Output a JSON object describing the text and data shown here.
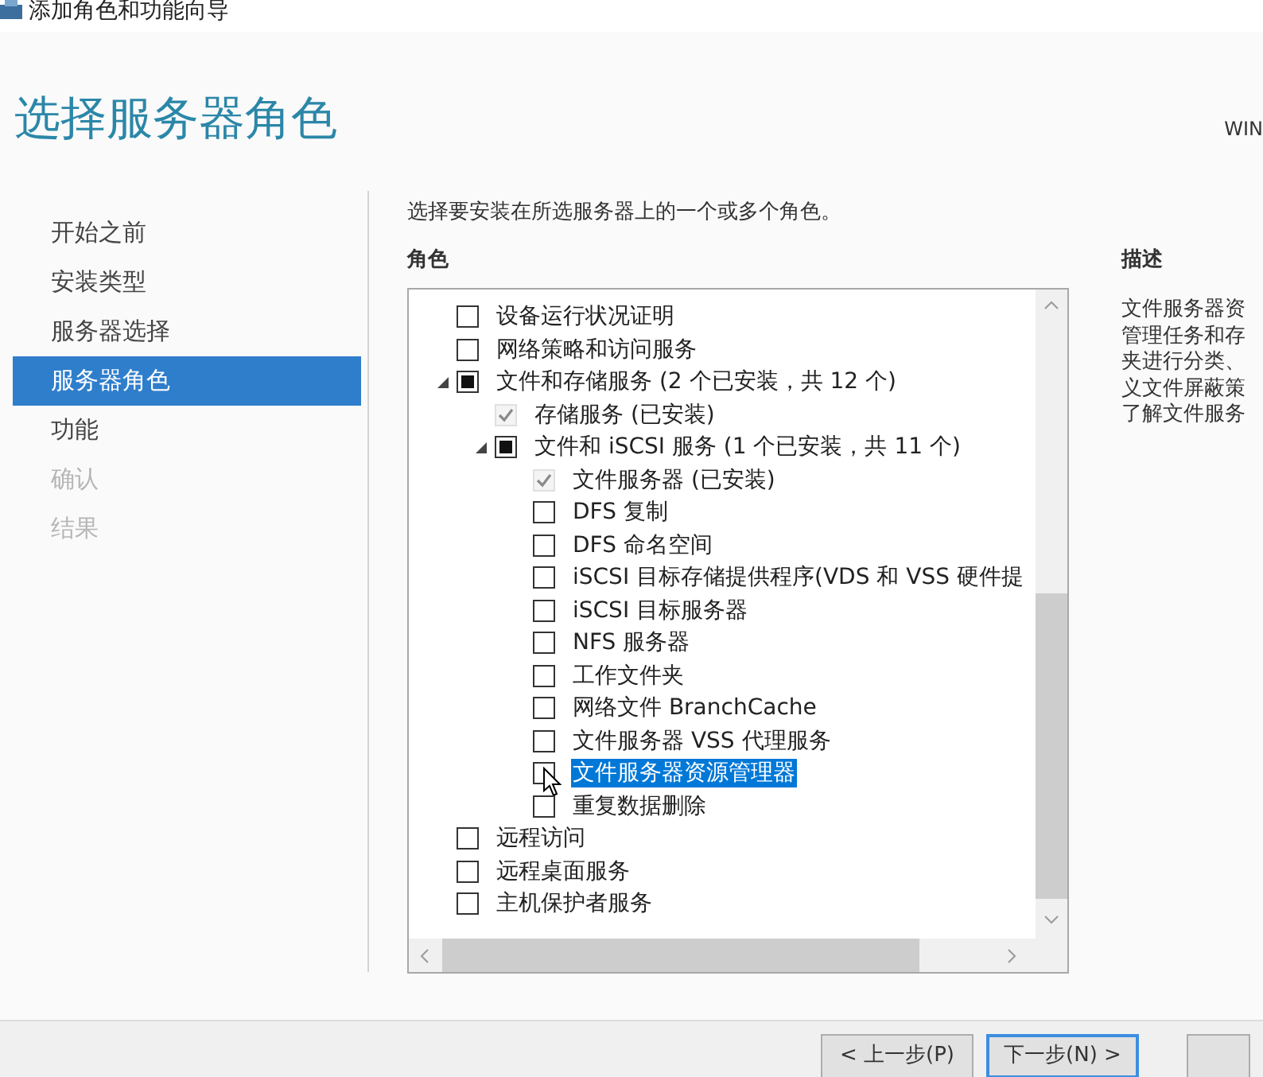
{
  "window": {
    "title": "添加角色和功能向导"
  },
  "heading": "选择服务器角色",
  "server_name": "WIN",
  "steps": [
    {
      "label": "开始之前",
      "selected": false,
      "disabled": false
    },
    {
      "label": "安装类型",
      "selected": false,
      "disabled": false
    },
    {
      "label": "服务器选择",
      "selected": false,
      "disabled": false
    },
    {
      "label": "服务器角色",
      "selected": true,
      "disabled": false
    },
    {
      "label": "功能",
      "selected": false,
      "disabled": false
    },
    {
      "label": "确认",
      "selected": false,
      "disabled": true
    },
    {
      "label": "结果",
      "selected": false,
      "disabled": true
    }
  ],
  "instruction": "选择要安装在所选服务器上的一个或多个角色。",
  "roles_label": "角色",
  "roles": [
    {
      "label": "设备运行状况证明",
      "checked": false,
      "indeterminate": false,
      "disabled": false,
      "selected": false
    },
    {
      "label": "网络策略和访问服务",
      "checked": false,
      "indeterminate": false,
      "disabled": false,
      "selected": false
    },
    {
      "label": "文件和存储服务 (2 个已安装，共 12 个)",
      "checked": false,
      "indeterminate": true,
      "disabled": false,
      "selected": false,
      "expanded": true,
      "children": [
        {
          "label": "存储服务 (已安装)",
          "checked": true,
          "indeterminate": false,
          "disabled": true,
          "selected": false
        },
        {
          "label": "文件和 iSCSI 服务 (1 个已安装，共 11 个)",
          "checked": false,
          "indeterminate": true,
          "disabled": false,
          "selected": false,
          "expanded": true,
          "children": [
            {
              "label": "文件服务器 (已安装)",
              "checked": true,
              "indeterminate": false,
              "disabled": true,
              "selected": false
            },
            {
              "label": "DFS 复制",
              "checked": false,
              "indeterminate": false,
              "disabled": false,
              "selected": false
            },
            {
              "label": "DFS 命名空间",
              "checked": false,
              "indeterminate": false,
              "disabled": false,
              "selected": false
            },
            {
              "label": "iSCSI 目标存储提供程序(VDS 和 VSS 硬件提",
              "checked": false,
              "indeterminate": false,
              "disabled": false,
              "selected": false
            },
            {
              "label": "iSCSI 目标服务器",
              "checked": false,
              "indeterminate": false,
              "disabled": false,
              "selected": false
            },
            {
              "label": "NFS 服务器",
              "checked": false,
              "indeterminate": false,
              "disabled": false,
              "selected": false
            },
            {
              "label": "工作文件夹",
              "checked": false,
              "indeterminate": false,
              "disabled": false,
              "selected": false
            },
            {
              "label": "网络文件 BranchCache",
              "checked": false,
              "indeterminate": false,
              "disabled": false,
              "selected": false
            },
            {
              "label": "文件服务器 VSS 代理服务",
              "checked": false,
              "indeterminate": false,
              "disabled": false,
              "selected": false
            },
            {
              "label": "文件服务器资源管理器",
              "checked": false,
              "indeterminate": false,
              "disabled": false,
              "selected": true
            },
            {
              "label": "重复数据删除",
              "checked": false,
              "indeterminate": false,
              "disabled": false,
              "selected": false
            }
          ]
        }
      ]
    },
    {
      "label": "远程访问",
      "checked": false,
      "indeterminate": false,
      "disabled": false,
      "selected": false
    },
    {
      "label": "远程桌面服务",
      "checked": false,
      "indeterminate": false,
      "disabled": false,
      "selected": false
    },
    {
      "label": "主机保护者服务",
      "checked": false,
      "indeterminate": false,
      "disabled": false,
      "selected": false
    }
  ],
  "description_label": "描述",
  "description_lines": [
    "文件服务器资",
    "管理任务和存",
    "夹进行分类、",
    "义文件屏蔽策",
    "了解文件服务"
  ],
  "buttons": [
    {
      "label": "< 上一步(P)",
      "focused": false
    },
    {
      "label": "下一步(N) >",
      "focused": true
    },
    {
      "focused": false
    }
  ]
}
